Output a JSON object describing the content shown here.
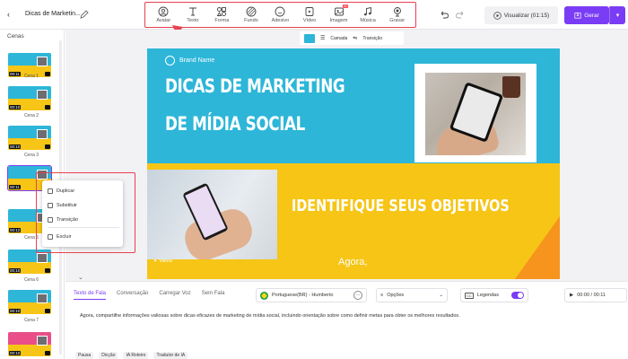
{
  "header": {
    "back_icon": "chevron-left-icon",
    "project_title": "Dicas de Marketin...",
    "edit_icon": "pencil-icon",
    "tools": [
      {
        "label": "Avatar",
        "icon": "avatar-icon"
      },
      {
        "label": "Texto",
        "icon": "text-icon"
      },
      {
        "label": "Forma",
        "icon": "shapes-icon"
      },
      {
        "label": "Fundo",
        "icon": "background-icon"
      },
      {
        "label": "Adesivo",
        "icon": "sticker-icon"
      },
      {
        "label": "Vídeo",
        "icon": "video-icon"
      },
      {
        "label": "Imagem",
        "icon": "image-icon",
        "badge": "AI"
      },
      {
        "label": "Música",
        "icon": "music-icon"
      },
      {
        "label": "Gravar",
        "icon": "record-icon"
      }
    ],
    "preview_label": "Visualizar (01:15)",
    "generate_label": "Gerar",
    "accent_color": "#7a3cf4",
    "highlight_color": "#e8414f"
  },
  "scenes_panel": {
    "title": "Cenas",
    "scenes": [
      {
        "label": "Cena 1",
        "duration": "00:11"
      },
      {
        "label": "Cena 2",
        "duration": "00:10"
      },
      {
        "label": "Cena 3",
        "duration": "00:10"
      },
      {
        "label": "",
        "duration": "00:11",
        "selected": true
      },
      {
        "label": "Cena 5",
        "duration": "00:12"
      },
      {
        "label": "Cena 6",
        "duration": "00:10"
      },
      {
        "label": "Cena 7",
        "duration": "00:10"
      },
      {
        "label": "",
        "duration": "00:10"
      }
    ]
  },
  "context_menu": {
    "items": [
      {
        "label": "Duplicar",
        "icon": "duplicate-icon"
      },
      {
        "label": "Substituir",
        "icon": "replace-icon"
      },
      {
        "label": "Transição",
        "icon": "transition-icon"
      },
      {
        "label": "Excluir",
        "icon": "trash-icon"
      }
    ]
  },
  "canvas_toolbar": {
    "camera_label": "Camada",
    "transition_label": "Transição",
    "swatch_color": "#2db6d8"
  },
  "slide": {
    "brand_name": "Brand Name",
    "title_line1": "DICAS DE MARKETING",
    "title_line2": "DE MÍDIA SOCIAL",
    "subtitle": "IDENTIFIQUE SEUS OBJETIVOS",
    "caption": "Agora,",
    "logo_text": "Vidnoz",
    "colors": {
      "top": "#2db6d8",
      "bottom": "#f6c516",
      "corner": "#f7941d"
    }
  },
  "bottom_panel": {
    "tabs": [
      "Texto de Fala",
      "Conversação",
      "Carregar Voz",
      "Sem Fala"
    ],
    "active_tab": "Texto de Fala",
    "voice": "Portuguese(BR) - Humberto",
    "options_label": "Opções",
    "captions_label": "Legendas",
    "time": "00:00 / 00:11",
    "narration": "Agora, compartilhe informações valiosas sobre dicas eficazes de marketing de mídia social, incluindo orientação sobre como definir metas para obter os melhores resultados.",
    "actions": [
      "Pausa",
      "Dicção",
      "IA Roteiro",
      "Tradutor de IA"
    ]
  }
}
